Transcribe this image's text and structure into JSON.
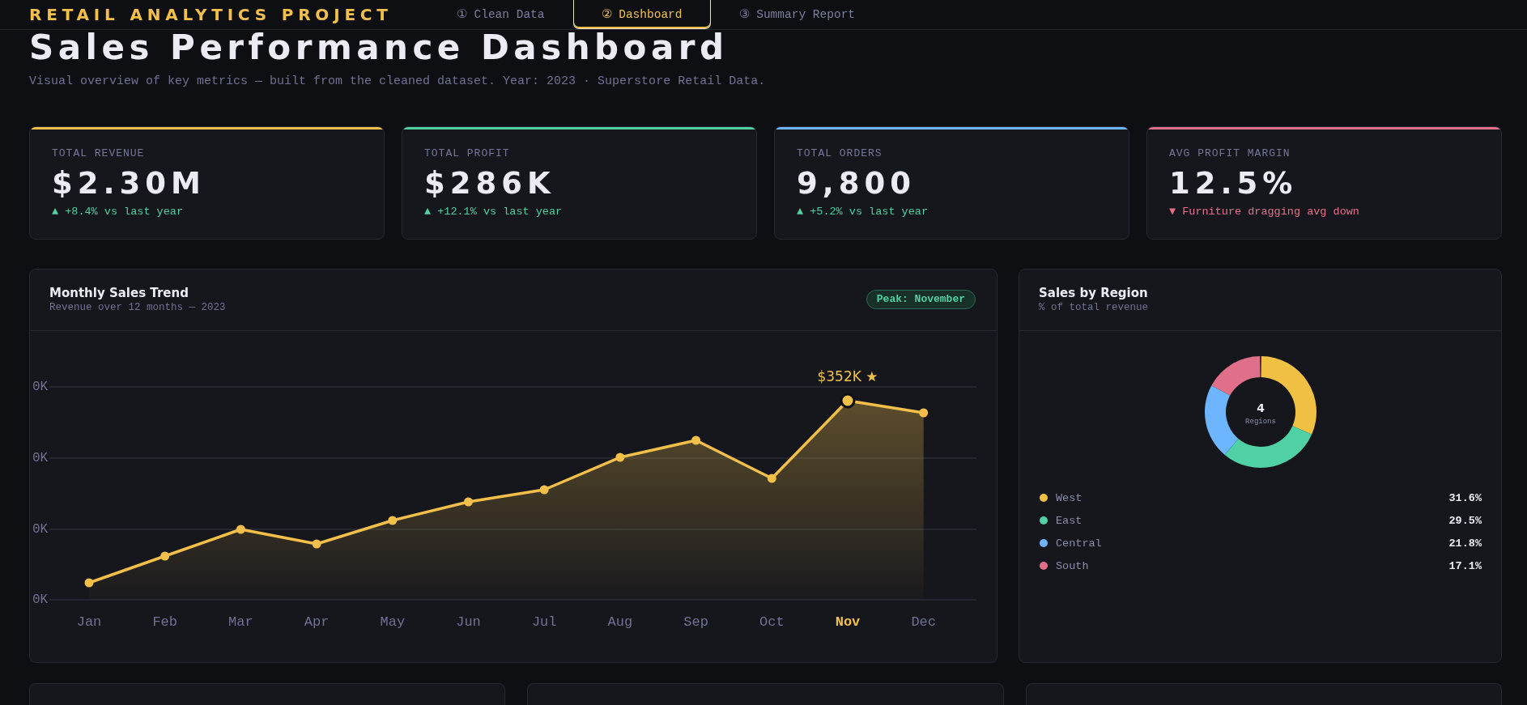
{
  "header": {
    "logo": "RETAIL ANALYTICS PROJECT",
    "tabs": [
      {
        "label": "① Clean Data",
        "selected": false
      },
      {
        "label": "② Dashboard",
        "selected": true
      },
      {
        "label": "③ Summary Report",
        "selected": false
      }
    ]
  },
  "page": {
    "title": "Sales Performance Dashboard",
    "subtitle": "Visual overview of key metrics — built from the cleaned dataset. Year: 2023 · Superstore Retail Data."
  },
  "kpis": [
    {
      "label": "TOTAL REVENUE",
      "value": "$2.30M",
      "delta": "▲ +8.4% vs last year",
      "positive": true,
      "color": "#f2c04a"
    },
    {
      "label": "TOTAL PROFIT",
      "value": "$286K",
      "delta": "▲ +12.1% vs last year",
      "positive": true,
      "color": "#4fd1a0"
    },
    {
      "label": "TOTAL ORDERS",
      "value": "9,800",
      "delta": "▲ +5.2% vs last year",
      "positive": true,
      "color": "#6db6ff"
    },
    {
      "label": "AVG PROFIT MARGIN",
      "value": "12.5%",
      "delta": "▼ Furniture dragging avg down",
      "positive": false,
      "color": "#e0708a"
    }
  ],
  "trend_chart": {
    "title": "Monthly Sales Trend",
    "subtitle": "Revenue over 12 months — 2023",
    "badge": "Peak: November",
    "y_labels": [
      "0K",
      "0K",
      "0K",
      "0K"
    ],
    "peak_label": "$352K ★",
    "months": [
      {
        "label": "Jan",
        "highlighted": false
      },
      {
        "label": "Feb",
        "highlighted": false
      },
      {
        "label": "Mar",
        "highlighted": false
      },
      {
        "label": "Apr",
        "highlighted": false
      },
      {
        "label": "May",
        "highlighted": false
      },
      {
        "label": "Jun",
        "highlighted": false
      },
      {
        "label": "Jul",
        "highlighted": false
      },
      {
        "label": "Aug",
        "highlighted": false
      },
      {
        "label": "Sep",
        "highlighted": false
      },
      {
        "label": "Oct",
        "highlighted": false
      },
      {
        "label": "Nov",
        "highlighted": true
      },
      {
        "label": "Dec",
        "highlighted": false
      }
    ]
  },
  "region_chart": {
    "title": "Sales by Region",
    "subtitle": "% of total revenue",
    "center_value": "4",
    "center_label": "Regions",
    "chart_data": {
      "type": "donut",
      "categories": [
        "West",
        "East",
        "Central",
        "South"
      ],
      "values": [
        31.6,
        29.5,
        21.8,
        17.1
      ]
    },
    "legend": [
      {
        "value": "31.6%",
        "color": "#f0c044"
      },
      {
        "value": "29.5%",
        "color": "#4fd1a5"
      },
      {
        "value": "21.8%",
        "color": "#6db6ff"
      },
      {
        "value": "17.1%",
        "color": "#e0708a"
      }
    ]
  }
}
